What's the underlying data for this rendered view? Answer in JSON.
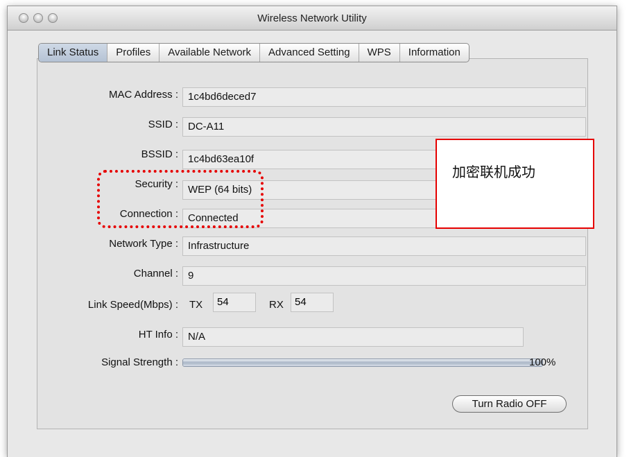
{
  "window": {
    "title": "Wireless Network Utility"
  },
  "tabs": [
    {
      "label": "Link Status",
      "selected": true
    },
    {
      "label": "Profiles",
      "selected": false
    },
    {
      "label": "Available Network",
      "selected": false
    },
    {
      "label": "Advanced Setting",
      "selected": false
    },
    {
      "label": "WPS",
      "selected": false
    },
    {
      "label": "Information",
      "selected": false
    }
  ],
  "fields": {
    "mac": {
      "label": "MAC Address :",
      "value": "1c4bd6deced7"
    },
    "ssid": {
      "label": "SSID :",
      "value": "DC-A11"
    },
    "bssid": {
      "label": "BSSID :",
      "value": "1c4bd63ea10f"
    },
    "security": {
      "label": "Security :",
      "value": "WEP (64 bits)"
    },
    "connection": {
      "label": "Connection :",
      "value": "Connected"
    },
    "network_type": {
      "label": "Network Type :",
      "value": "Infrastructure"
    },
    "channel": {
      "label": "Channel :",
      "value": "9"
    },
    "link_speed": {
      "label": "Link Speed(Mbps) :",
      "tx_label": "TX",
      "tx_value": "54",
      "rx_label": "RX",
      "rx_value": "54"
    },
    "ht_info": {
      "label": "HT Info :",
      "value": "N/A"
    },
    "signal": {
      "label": "Signal Strength :",
      "percent_text": "100%",
      "level": 1.0
    }
  },
  "buttons": {
    "radio_off": "Turn Radio OFF"
  },
  "annotation": {
    "text": "加密联机成功",
    "color": "#e60000"
  }
}
